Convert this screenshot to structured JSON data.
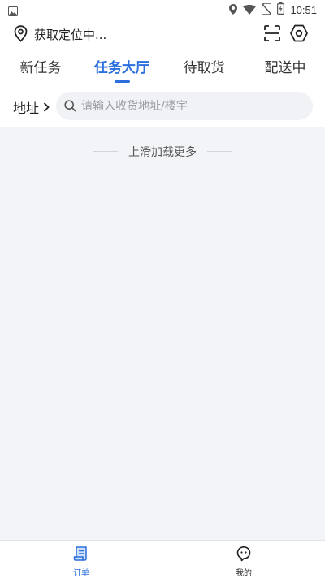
{
  "status_bar": {
    "time": "10:51",
    "left_icon": "image-icon",
    "icons": [
      "location-icon",
      "wifi-icon",
      "no-sim-icon",
      "battery-charging-icon"
    ]
  },
  "location": {
    "text": "获取定位中...",
    "icon": "map-pin-icon",
    "actions": [
      "scan-icon",
      "settings-icon"
    ]
  },
  "tabs": [
    {
      "label": "新任务",
      "active": false
    },
    {
      "label": "任务大厅",
      "active": true
    },
    {
      "label": "待取货",
      "active": false
    },
    {
      "label": "配送中",
      "active": false
    }
  ],
  "filter": {
    "address_label": "地址",
    "search_placeholder": "请输入收货地址/楼宇",
    "search_value": ""
  },
  "content": {
    "load_more_text": "上滑加载更多"
  },
  "bottom_nav": [
    {
      "label": "订单",
      "icon": "order-icon",
      "active": true
    },
    {
      "label": "我的",
      "icon": "profile-icon",
      "active": false
    }
  ],
  "colors": {
    "accent": "#2b6fde",
    "background": "#f3f4f7",
    "text": "#222222"
  }
}
